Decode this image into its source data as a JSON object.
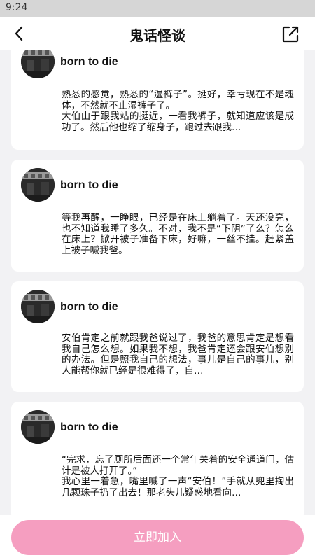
{
  "status_bar": {
    "time": "9:24"
  },
  "header": {
    "title": "鬼话怪谈",
    "back_icon": "chevron-left-icon",
    "share_icon": "share-external-icon"
  },
  "posts": [
    {
      "author": "born to die",
      "excerpt": "熟悉的感觉，熟悉的“湿裤子”。挺好，幸亏现在不是魂体，不然就不止湿裤子了。\n大伯由于跟我站的挺近，一看我裤子，就知道应该是成功了。然后他也缩了缩身子，跑过去跟我…"
    },
    {
      "author": "born to die",
      "excerpt": "等我再醒，一睁眼，已经是在床上躺着了。天还没亮，也不知道我睡了多久。不对，我不是“下阴”了么？怎么在床上？掀开被子准备下床，好嘛，一丝不挂。赶紧盖上被子喊我爸。"
    },
    {
      "author": "born to die",
      "excerpt": "安伯肯定之前就跟我爸说过了，我爸的意思肯定是想看我自己怎么想。如果我不想，我爸肯定还会跟安伯想别的办法。但是照我自己的想法，事儿是自己的事儿，别人能帮你就已经是很难得了，自…"
    },
    {
      "author": "born to die",
      "excerpt": "“完求，忘了厕所后面还一个常年关着的安全通道门，估计是被人打开了。”\n我心里一着急，嘴里喊了一声“安伯！”手就从兜里掏出几颗珠子扔了出去！那老头儿疑惑地看向…"
    }
  ],
  "footer": {
    "join_label": "立即加入"
  },
  "colors": {
    "accent": "#f59ec0",
    "background": "#f2f2f4"
  }
}
